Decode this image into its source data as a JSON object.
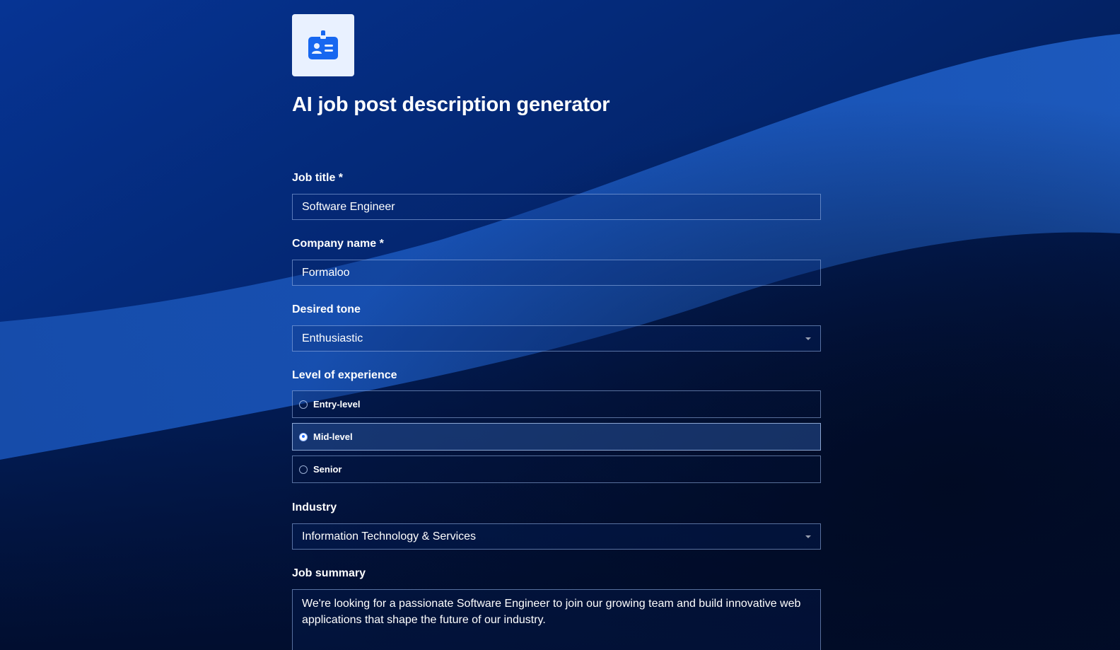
{
  "header": {
    "logo_icon": "id-badge-icon",
    "title": "AI job post description generator"
  },
  "fields": {
    "job_title": {
      "label": "Job title *",
      "value": "Software Engineer"
    },
    "company_name": {
      "label": "Company name *",
      "value": "Formaloo"
    },
    "desired_tone": {
      "label": "Desired tone",
      "value": "Enthusiastic"
    },
    "experience": {
      "label": "Level of experience",
      "options": [
        "Entry-level",
        "Mid-level",
        "Senior"
      ],
      "selected": "Mid-level"
    },
    "industry": {
      "label": "Industry",
      "value": "Information Technology & Services"
    },
    "job_summary": {
      "label": "Job summary",
      "value": "We're looking for a passionate Software Engineer to join our growing team and build innovative web applications that shape the future of our industry."
    }
  },
  "colors": {
    "background": "#02153d",
    "wave": "#1b56b8",
    "logo_tile": "#e9f1ff",
    "accent": "#1e6cff"
  }
}
